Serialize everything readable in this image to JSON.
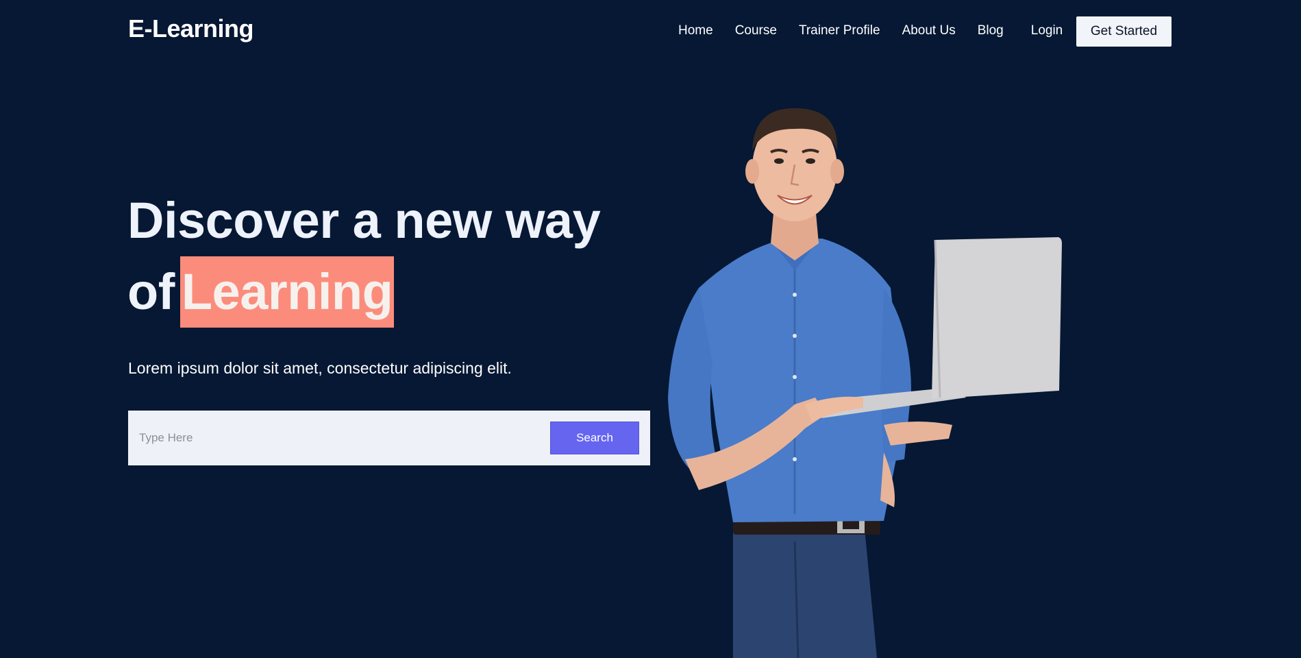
{
  "header": {
    "logo": "E-Learning",
    "nav": [
      {
        "label": "Home"
      },
      {
        "label": "Course"
      },
      {
        "label": "Trainer Profile"
      },
      {
        "label": "About Us"
      },
      {
        "label": "Blog"
      }
    ],
    "login_label": "Login",
    "cta_label": "Get Started"
  },
  "hero": {
    "headline_line1": "Discover a new way",
    "headline_line2_prefix": "of",
    "headline_highlight": "Learning",
    "subtitle": "Lorem ipsum dolor sit amet, consectetur adipiscing elit."
  },
  "search": {
    "placeholder": "Type Here",
    "button_label": "Search"
  },
  "colors": {
    "background": "#061833",
    "highlight": "#fb8c7c",
    "search_button": "#6665f0",
    "cta_background": "#f1f4f9"
  },
  "image": {
    "icon": "person-with-laptop-photo"
  }
}
